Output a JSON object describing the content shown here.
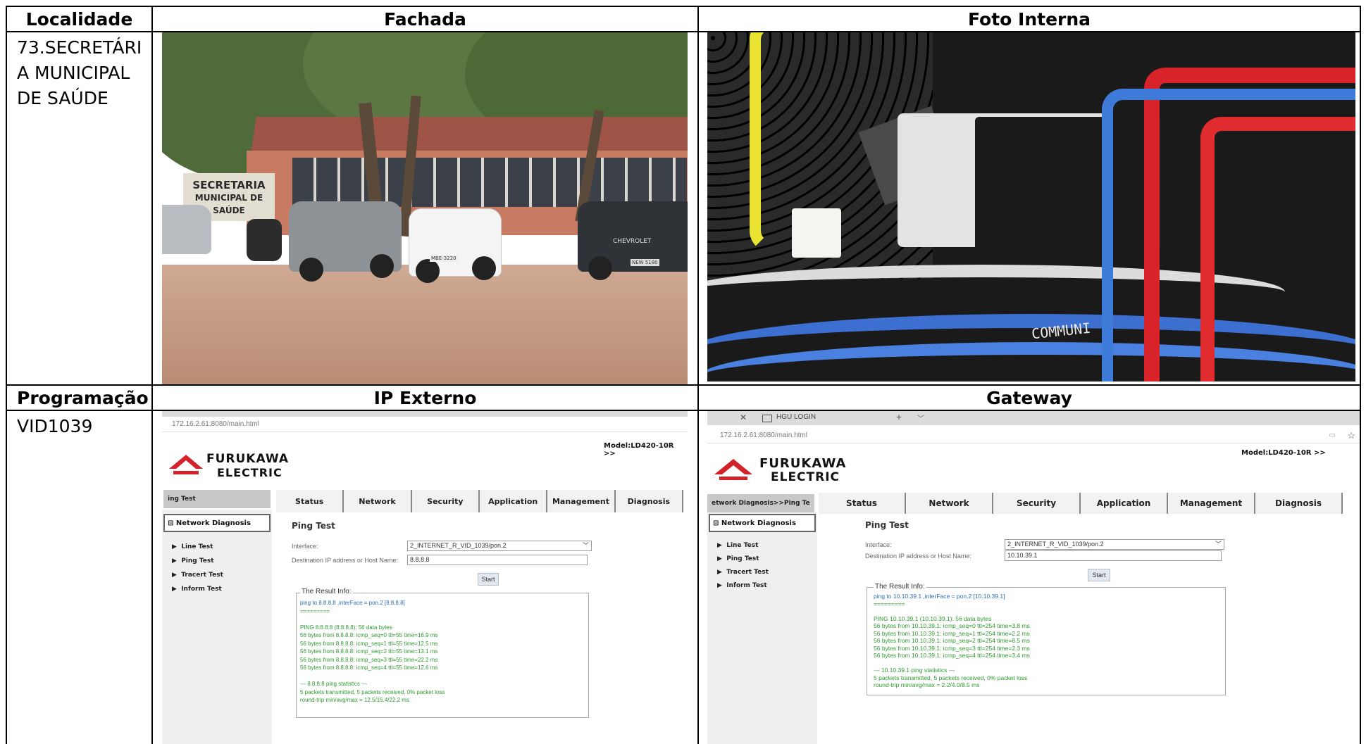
{
  "headers": {
    "localidade": "Localidade",
    "fachada": "Fachada",
    "foto_interna": "Foto Interna",
    "programacao": "Programação",
    "ip_externo": "IP Externo",
    "gateway": "Gateway"
  },
  "location_lines": [
    "73.SECRETÁRI",
    "A MUNICIPAL",
    "DE SAÚDE"
  ],
  "programacao_value": "VID1039",
  "facade_photo": {
    "sign_line1": "SECRETARIA",
    "sign_line2": "MUNICIPAL DE SAÚDE",
    "plate1": "",
    "plate2": "MBE-3220",
    "truck_text": "CHEVROLET",
    "truck_plate": "NEW 5180"
  },
  "internal_photo": {
    "device_text": "COMMUNI"
  },
  "ip_externo": {
    "url": "172.16.2.61:8080/main.html",
    "model": "Model:LD420-10R  >>",
    "brand_line1": "FURUKAWA",
    "brand_line2": "ELECTRIC",
    "breadcrumb": "ing Test",
    "tabs": [
      "Status",
      "Network",
      "Security",
      "Application",
      "Management",
      "Diagnosis"
    ],
    "side_header": "⊟ Network Diagnosis",
    "side_items": [
      "Line Test",
      "Ping Test",
      "Tracert Test",
      "Inform Test"
    ],
    "page_title": "Ping Test",
    "interface_label": "Interface:",
    "interface_value": "2_INTERNET_R_VID_1039/pon.2",
    "dest_label": "Destination IP address or Host Name:",
    "dest_value": "8.8.8.8",
    "start_label": "Start",
    "result_legend": "The Result Info:",
    "result_lines": [
      "ping to 8.8.8.8 ,interFace = pon.2 [8.8.8.8]",
      "=========",
      "",
      "PING 8.8.8.8 (8.8.8.8): 56 data bytes",
      "56 bytes from 8.8.8.8: icmp_seq=0 ttl=55 time=16.9 ms",
      "56 bytes from 8.8.8.8: icmp_seq=1 ttl=55 time=12.5 ms",
      "56 bytes from 8.8.8.8: icmp_seq=2 ttl=55 time=13.1 ms",
      "56 bytes from 8.8.8.8: icmp_seq=3 ttl=55 time=22.2 ms",
      "56 bytes from 8.8.8.8: icmp_seq=4 ttl=55 time=12.6 ms",
      "",
      "--- 8.8.8.8 ping statistics ---",
      "5 packets transmitted, 5 packets received, 0% packet loss",
      "round-trip min/avg/max = 12.5/15.4/22.2 ms"
    ]
  },
  "gateway": {
    "tab_title": "HGU LOGIN",
    "url": "172.16.2.61:8080/main.html",
    "model": "Model:LD420-10R  >>",
    "brand_line1": "FURUKAWA",
    "brand_line2": "ELECTRIC",
    "breadcrumb": "etwork Diagnosis>>Ping Te",
    "tabs": [
      "Status",
      "Network",
      "Security",
      "Application",
      "Management",
      "Diagnosis"
    ],
    "side_header": "⊟ Network Diagnosis",
    "side_items": [
      "Line Test",
      "Ping Test",
      "Tracert Test",
      "Inform Test"
    ],
    "page_title": "Ping Test",
    "interface_label": "Interface:",
    "interface_value": "2_INTERNET_R_VID_1039/pon.2",
    "dest_label": "Destination IP address or Host Name:",
    "dest_value": "10.10.39.1",
    "start_label": "Start",
    "result_legend": "The Result Info:",
    "result_lines": [
      "ping to 10.10.39.1 ,interFace = pon.2 [10.10.39.1]",
      "=========",
      "",
      "PING 10.10.39.1 (10.10.39.1): 56 data bytes",
      "56 bytes from 10.10.39.1: icmp_seq=0 ttl=254 time=3.8 ms",
      "56 bytes from 10.10.39.1: icmp_seq=1 ttl=254 time=2.2 ms",
      "56 bytes from 10.10.39.1: icmp_seq=2 ttl=254 time=8.5 ms",
      "56 bytes from 10.10.39.1: icmp_seq=3 ttl=254 time=2.3 ms",
      "56 bytes from 10.10.39.1: icmp_seq=4 ttl=254 time=3.4 ms",
      "",
      "--- 10.10.39.1 ping statistics ---",
      "5 packets transmitted, 5 packets received, 0% packet loss",
      "round-trip min/avg/max = 2.2/4.0/8.5 ms"
    ]
  }
}
